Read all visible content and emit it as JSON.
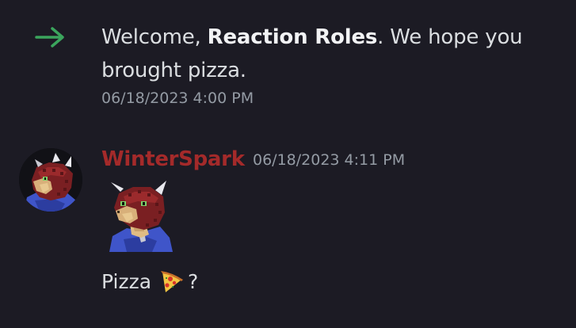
{
  "join_message": {
    "prefix": "Welcome, ",
    "name": "Reaction Roles",
    "suffix": ". We hope you brought pizza.",
    "timestamp": "06/18/2023 4:00 PM",
    "arrow_color": "#3ba55d"
  },
  "message": {
    "author": "WinterSpark",
    "author_color": "#a42a2a",
    "timestamp": "06/18/2023 4:11 PM",
    "text_before": "Pizza",
    "emoji": "pizza-icon",
    "text_after": "?"
  }
}
